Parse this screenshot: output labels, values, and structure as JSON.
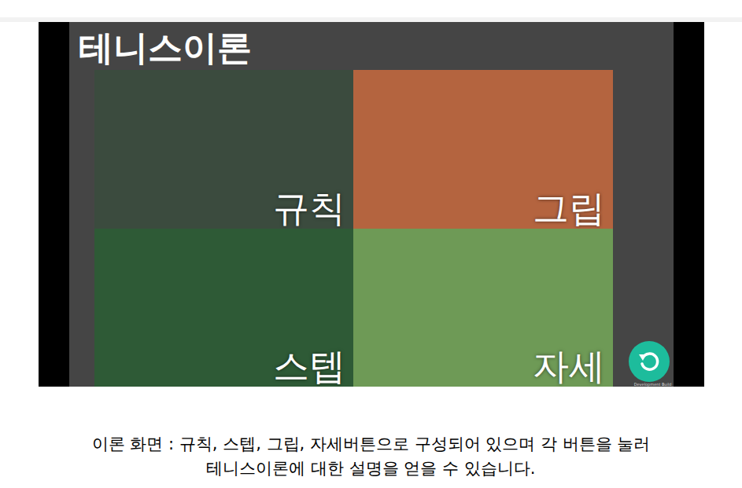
{
  "window": {
    "title": "테니스이론"
  },
  "menu_buttons": [
    {
      "label": "규칙",
      "color": "#3b4b3e"
    },
    {
      "label": "그립",
      "color": "#b4643f"
    },
    {
      "label": "스텝",
      "color": "#2e5a36"
    },
    {
      "label": "자세",
      "color": "#6e9a56"
    }
  ],
  "build_label": "Development Build",
  "caption": [
    "이론 화면 : 규칙, 스텝, 그립, 자세버튼으로 구성되어 있으며 각 버튼을 눌러",
    "테니스이론에 대한 설명을 얻을 수 있습니다."
  ]
}
